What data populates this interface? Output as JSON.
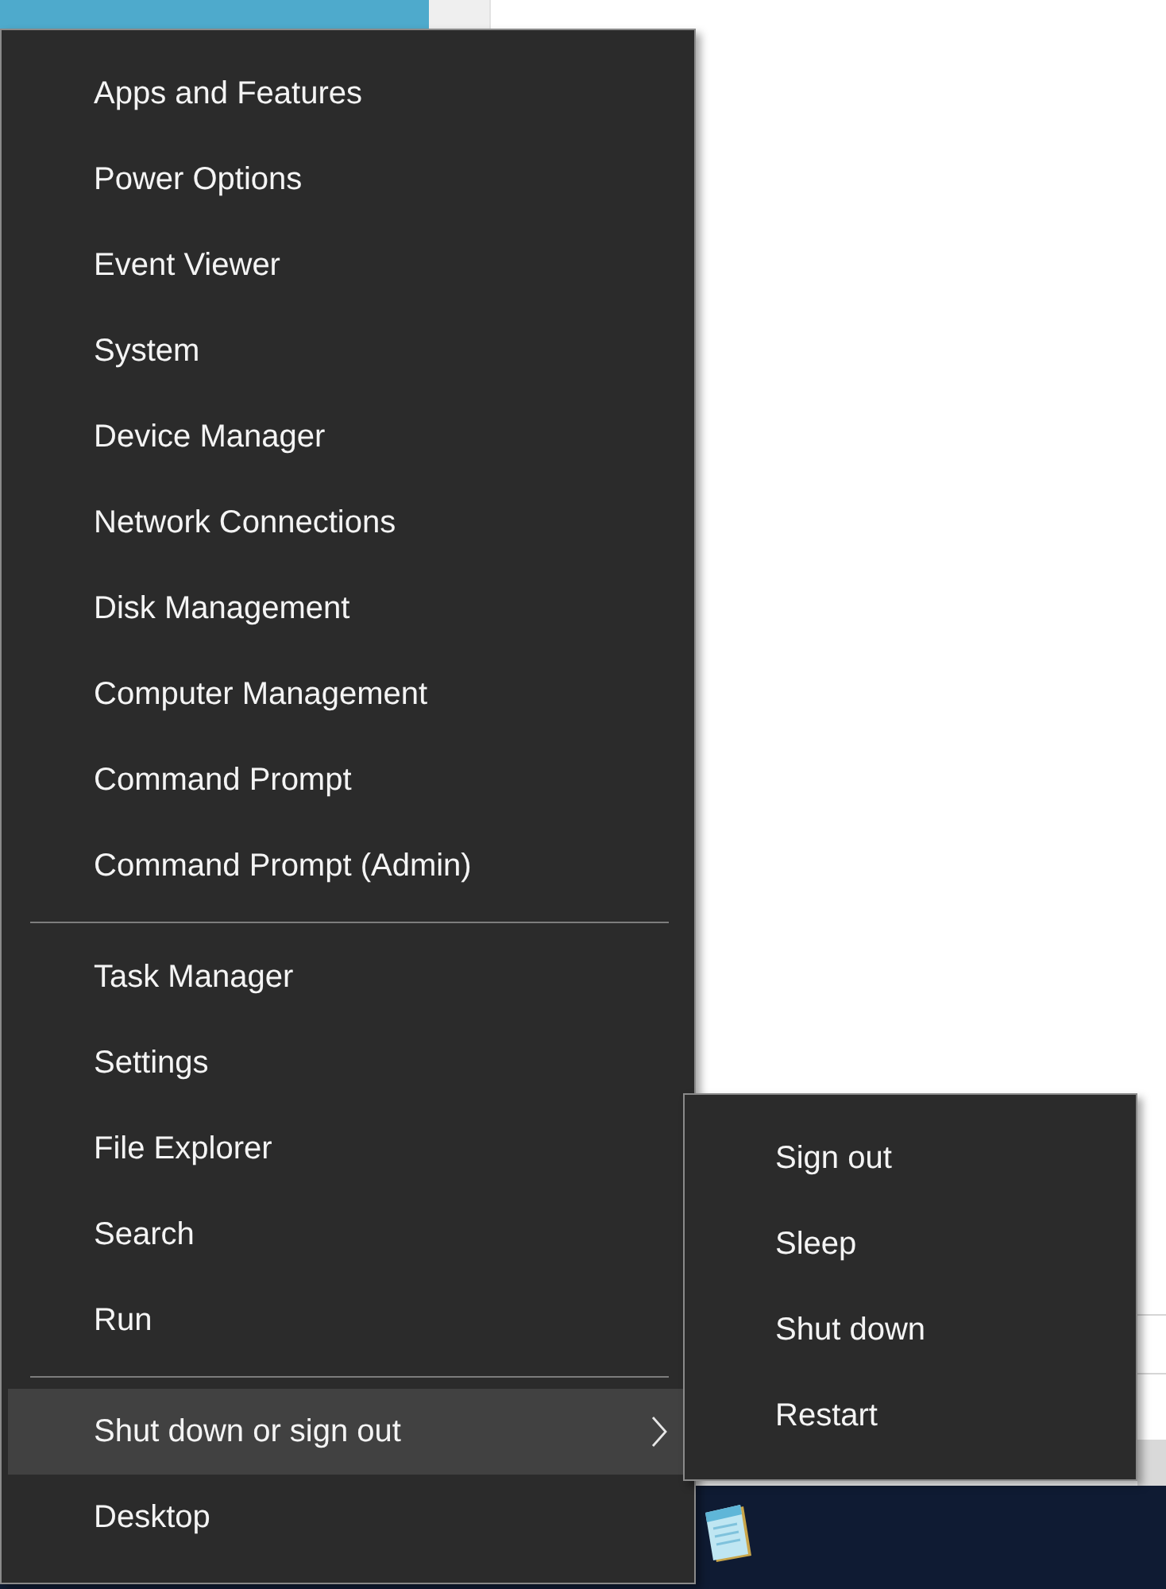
{
  "menu": {
    "sections": [
      {
        "items": [
          {
            "label": "Apps and Features",
            "kind": "command",
            "selected": false
          },
          {
            "label": "Power Options",
            "kind": "command",
            "selected": false
          },
          {
            "label": "Event Viewer",
            "kind": "command",
            "selected": false
          },
          {
            "label": "System",
            "kind": "command",
            "selected": false
          },
          {
            "label": "Device Manager",
            "kind": "command",
            "selected": false
          },
          {
            "label": "Network Connections",
            "kind": "command",
            "selected": false
          },
          {
            "label": "Disk Management",
            "kind": "command",
            "selected": false
          },
          {
            "label": "Computer Management",
            "kind": "command",
            "selected": false
          },
          {
            "label": "Command Prompt",
            "kind": "command",
            "selected": false
          },
          {
            "label": "Command Prompt (Admin)",
            "kind": "command",
            "selected": false
          }
        ]
      },
      {
        "items": [
          {
            "label": "Task Manager",
            "kind": "command",
            "selected": false
          },
          {
            "label": "Settings",
            "kind": "command",
            "selected": false
          },
          {
            "label": "File Explorer",
            "kind": "command",
            "selected": false
          },
          {
            "label": "Search",
            "kind": "command",
            "selected": false
          },
          {
            "label": "Run",
            "kind": "command",
            "selected": false
          }
        ]
      },
      {
        "items": [
          {
            "label": "Shut down or sign out",
            "kind": "submenu",
            "selected": true
          },
          {
            "label": "Desktop",
            "kind": "command",
            "selected": false
          }
        ]
      }
    ]
  },
  "submenu": {
    "items": [
      {
        "label": "Sign out"
      },
      {
        "label": "Sleep"
      },
      {
        "label": "Shut down"
      },
      {
        "label": "Restart"
      }
    ]
  }
}
